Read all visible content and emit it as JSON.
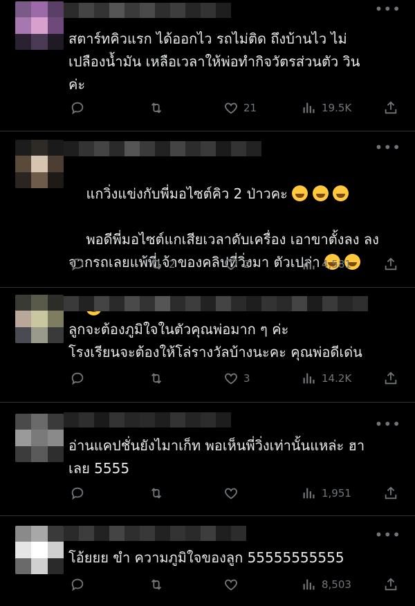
{
  "posts": [
    {
      "text": "สตาร์ทคิวแรก ได้ออกไว รถไม่ติด ถึงบ้านไว ไม่\nเปลืองน้ำมัน เหลือเวลาให้พ่อทำกิจวัตรส่วนตัว วิน\nค่ะ",
      "reply": "",
      "repost": "",
      "like": "21",
      "views": "19.5K"
    },
    {
      "text": "แกวิ่งแข่งกับพี่มอไซต์คิว 2 ป่าวคะ ",
      "text2": "พอดีพี่มอไซต์แกเสียเวลาดับเครื่อง เอาขาตั้งลง ลง\nจากรถเลยแพ้พี่เจ้าของคลิปที่วิ่งมา ตัวเปล่า ",
      "reply": "",
      "repost": "2",
      "like": "2",
      "views": "4,581"
    },
    {
      "text": "ลูกจะต้องภูมิใจในตัวคุณพ่อมาก ๆ ค่ะ\nโรงเรียนจะต้องให้โล่รางวัลบ้างนะคะ คุณพ่อดีเด่น",
      "reply": "",
      "repost": "",
      "like": "3",
      "views": "14.2K"
    },
    {
      "text": "อ่านแคปชั่นยังไมาเก็ท พอเห็นพี่วิ่งเท่านั้นแหล่ะ ฮา\nเลย 5555",
      "reply": "",
      "repost": "",
      "like": "",
      "views": "1,951"
    },
    {
      "text": "โอ้ยยย ขำ ความภูมิใจของลูก 55555555555",
      "reply": "",
      "repost": "",
      "like": "",
      "views": "8,503"
    }
  ],
  "icons": [
    "more-icon",
    "reply-icon",
    "repost-icon",
    "like-icon",
    "views-icon",
    "share-icon",
    "emoji-icon"
  ],
  "colors": {
    "background": "#000000",
    "text": "#e7e9ea",
    "muted": "#71767b",
    "divider": "#2f3336"
  }
}
